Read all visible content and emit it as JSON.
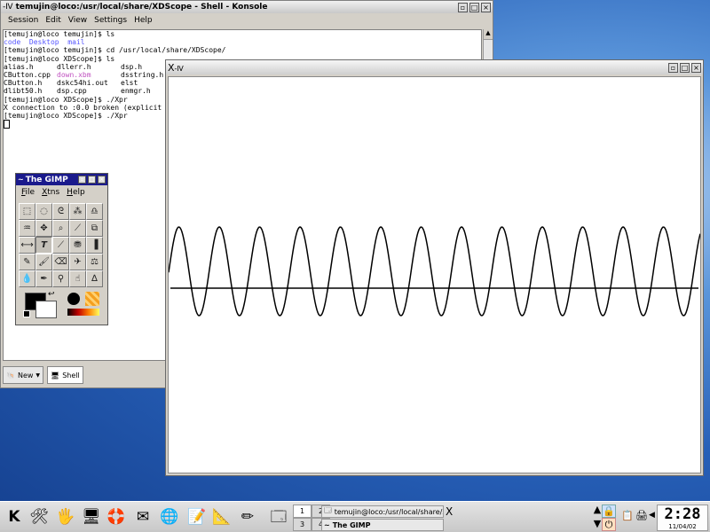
{
  "konsole": {
    "title": "temujin@loco:/usr/local/share/XDScope - Shell - Konsole",
    "menu": [
      "Session",
      "Edit",
      "View",
      "Settings",
      "Help"
    ],
    "terminal": {
      "line1": "[temujin@loco temujin]$ ls",
      "line2": [
        "code",
        "Desktop",
        "mail"
      ],
      "line3": "[temujin@loco temujin]$ cd /usr/local/share/XDScope/",
      "line4": "[temujin@loco XDScope]$ ls",
      "ls_rows": [
        [
          "alias.h",
          "dllerr.h",
          "dsp.h"
        ],
        [
          "CButton.cpp",
          "down.xbm",
          "dsstring.h"
        ],
        [
          "CButton.h",
          "dskc54hi.out",
          "elst"
        ],
        [
          "dlibt50.h",
          "dsp.cpp",
          "enmgr.h"
        ]
      ],
      "line9": "[temujin@loco XDScope]$ ./Xpr",
      "line10": "X connection to :0.0 broken (explicit",
      "line11": "[temujin@loco XDScope]$ ./Xpr"
    },
    "tabs": {
      "new": "New",
      "shell": "Shell"
    }
  },
  "xdscope": {
    "title": "X"
  },
  "gimp": {
    "title": "The GIMP",
    "menu": [
      "File",
      "Xtns",
      "Help"
    ]
  },
  "taskbar": {
    "pager": [
      "1",
      "2",
      "3",
      "4"
    ],
    "tasks": [
      {
        "label": "temujin@loco:/usr/local/share/XDScop"
      },
      {
        "label": "The GIMP"
      }
    ],
    "x_label": "X",
    "clock_time": "2:28",
    "clock_date": "11/04/02"
  },
  "colors": {
    "gimp_title": "#1a1a8c",
    "terminal_blue": "#5555ff",
    "terminal_magenta": "#c050c0"
  }
}
